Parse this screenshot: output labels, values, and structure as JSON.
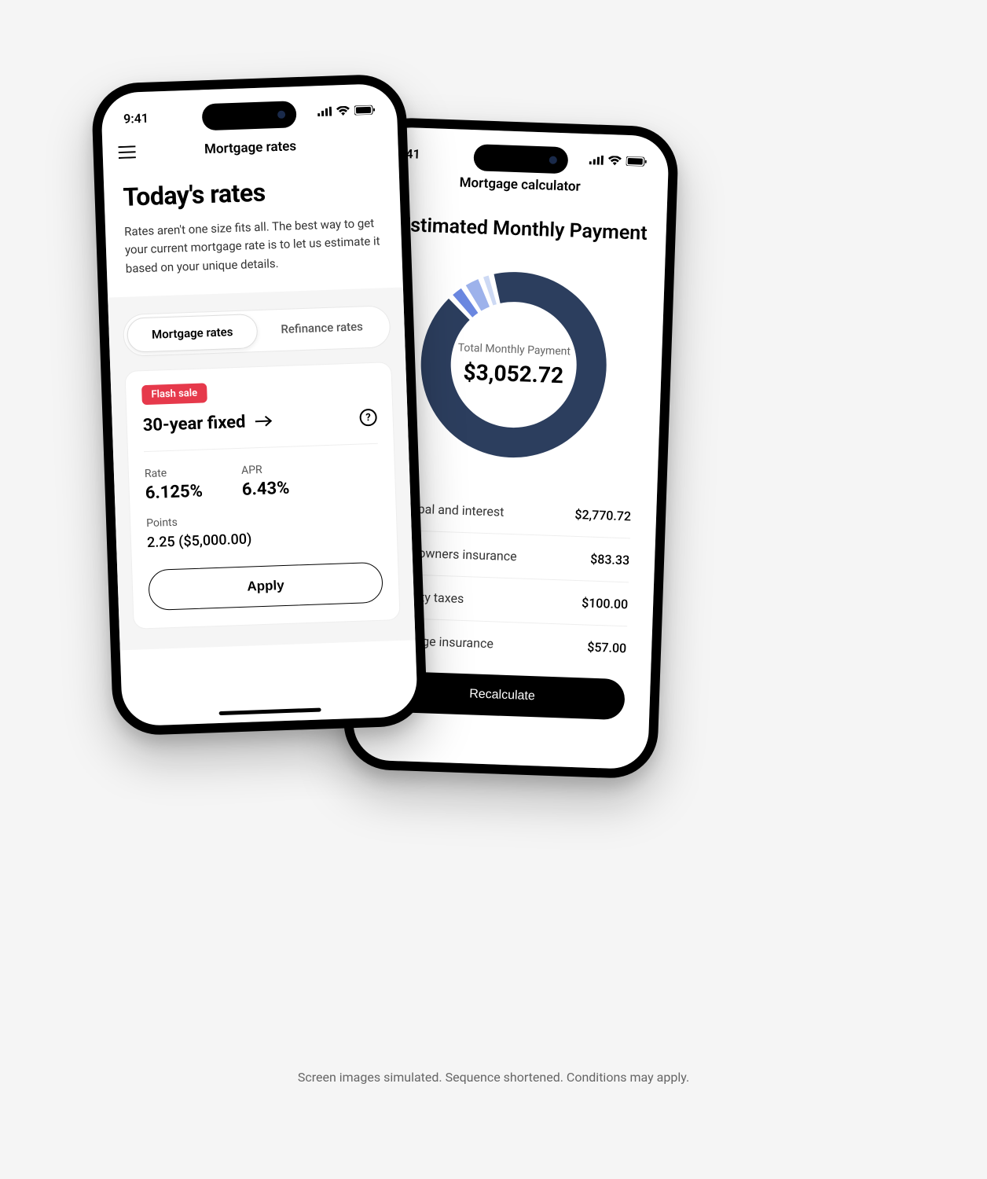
{
  "status": {
    "time": "9:41"
  },
  "phone1": {
    "nav_title": "Mortgage rates",
    "heading": "Today's rates",
    "body": "Rates aren't one size fits all. The best way to get your current mortgage rate is to let us estimate it based on your unique details.",
    "tabs": [
      "Mortgage rates",
      "Refinance rates"
    ],
    "badge": "Flash sale",
    "product": "30-year fixed",
    "rate_label": "Rate",
    "rate_value": "6.125%",
    "apr_label": "APR",
    "apr_value": "6.43%",
    "points_label": "Points",
    "points_value": "2.25 ($5,000.00)",
    "apply": "Apply"
  },
  "phone2": {
    "nav_title": "Mortgage calculator",
    "heading": "Estimated Monthly Payment",
    "donut_label": "Total Monthly Payment",
    "donut_value": "$3,052.72",
    "breakdown": [
      {
        "label": "Principal and interest",
        "value": "$2,770.72"
      },
      {
        "label": "Homeowners insurance",
        "value": "$83.33"
      },
      {
        "label": "Property taxes",
        "value": "$100.00"
      },
      {
        "label": "Mortgage insurance",
        "value": "$57.00"
      }
    ],
    "recalculate": "Recalculate"
  },
  "chart_data": {
    "type": "pie",
    "title": "Total Monthly Payment",
    "total": 3052.72,
    "series": [
      {
        "name": "Principal and interest",
        "value": 2770.72,
        "color": "#2c3e5e"
      },
      {
        "name": "Homeowners insurance",
        "value": 83.33,
        "color": "#6a87e0"
      },
      {
        "name": "Property taxes",
        "value": 100.0,
        "color": "#9db2eb"
      },
      {
        "name": "Mortgage insurance",
        "value": 57.0,
        "color": "#cdd9f4"
      }
    ]
  },
  "disclaimer": "Screen images simulated. Sequence shortened. Conditions may apply."
}
